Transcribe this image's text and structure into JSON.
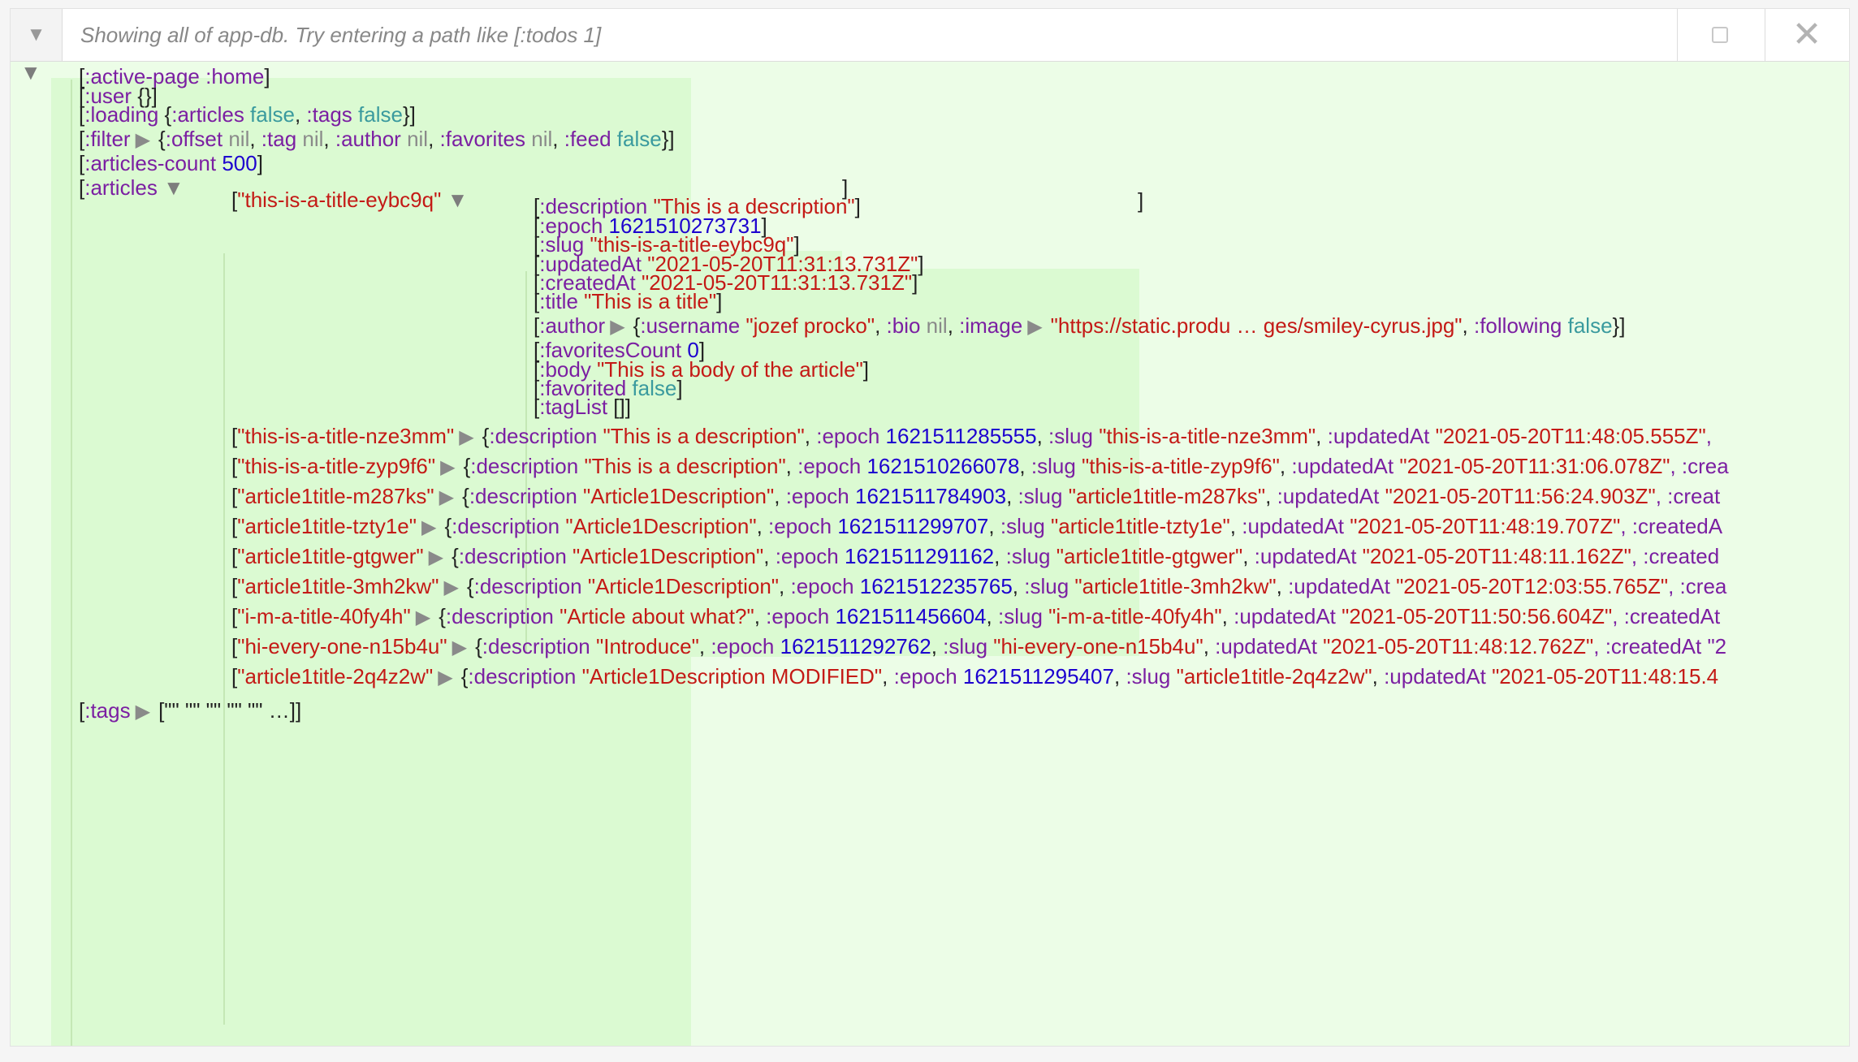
{
  "header": {
    "path_placeholder": "Showing all of app-db. Try entering a path like [:todos 1]",
    "toggle_icon": "triangle-down-icon",
    "checkbox_icon": "checkbox-icon",
    "close_icon": "close-icon"
  },
  "db": {
    "active_page": {
      "key": ":active-page",
      "value": ":home"
    },
    "user": {
      "key": ":user",
      "value": "{}"
    },
    "loading": {
      "key": ":loading",
      "k1": ":articles",
      "v1": "false",
      "k2": ":tags",
      "v2": "false"
    },
    "filter": {
      "key": ":filter",
      "k1": ":offset",
      "v1": "nil",
      "k2": ":tag",
      "v2": "nil",
      "k3": ":author",
      "v3": "nil",
      "k4": ":favorites",
      "v4": "nil",
      "k5": ":feed",
      "v5": "false"
    },
    "articles_count": {
      "key": ":articles-count",
      "value": "500"
    },
    "articles": {
      "key": ":articles",
      "expanded": {
        "slug": "\"this-is-a-title-eybc9q\"",
        "fields": {
          "description": {
            "key": ":description",
            "value": "\"This is a description\""
          },
          "epoch": {
            "key": ":epoch",
            "value": "1621510273731"
          },
          "slug": {
            "key": ":slug",
            "value": "\"this-is-a-title-eybc9q\""
          },
          "updatedAt": {
            "key": ":updatedAt",
            "value": "\"2021-05-20T11:31:13.731Z\""
          },
          "createdAt": {
            "key": ":createdAt",
            "value": "\"2021-05-20T11:31:13.731Z\""
          },
          "title": {
            "key": ":title",
            "value": "\"This is a title\""
          },
          "author": {
            "key": ":author",
            "k_username": ":username",
            "v_username": "\"jozef procko\"",
            "k_bio": ":bio",
            "v_bio": "nil",
            "k_image": ":image",
            "v_image": "\"https://static.produ … ges/smiley-cyrus.jpg\"",
            "k_following": ":following",
            "v_following": "false"
          },
          "favoritesCount": {
            "key": ":favoritesCount",
            "value": "0"
          },
          "body": {
            "key": ":body",
            "value": "\"This is a body of the article\""
          },
          "favorited": {
            "key": ":favorited",
            "value": "false"
          },
          "tagList": {
            "key": ":tagList",
            "value": "[]"
          }
        }
      },
      "rows": [
        {
          "slug": "\"this-is-a-title-nze3mm\"",
          "desc": "\"This is a description\"",
          "epoch": "1621511285555",
          "slug2": "\"this-is-a-title-nze3mm\"",
          "updated": "\"2021-05-20T11:48:05.555Z\"",
          "tail": ","
        },
        {
          "slug": "\"this-is-a-title-zyp9f6\"",
          "desc": "\"This is a description\"",
          "epoch": "1621510266078",
          "slug2": "\"this-is-a-title-zyp9f6\"",
          "updated": "\"2021-05-20T11:31:06.078Z\"",
          "tail": ", :crea"
        },
        {
          "slug": "\"article1title-m287ks\"",
          "desc": "\"Article1Description\"",
          "epoch": "1621511784903",
          "slug2": "\"article1title-m287ks\"",
          "updated": "\"2021-05-20T11:56:24.903Z\"",
          "tail": ", :creat"
        },
        {
          "slug": "\"article1title-tzty1e\"",
          "desc": "\"Article1Description\"",
          "epoch": "1621511299707",
          "slug2": "\"article1title-tzty1e\"",
          "updated": "\"2021-05-20T11:48:19.707Z\"",
          "tail": ", :createdA"
        },
        {
          "slug": "\"article1title-gtgwer\"",
          "desc": "\"Article1Description\"",
          "epoch": "1621511291162",
          "slug2": "\"article1title-gtgwer\"",
          "updated": "\"2021-05-20T11:48:11.162Z\"",
          "tail": ", :created"
        },
        {
          "slug": "\"article1title-3mh2kw\"",
          "desc": "\"Article1Description\"",
          "epoch": "1621512235765",
          "slug2": "\"article1title-3mh2kw\"",
          "updated": "\"2021-05-20T12:03:55.765Z\"",
          "tail": ", :crea"
        },
        {
          "slug": "\"i-m-a-title-40fy4h\"",
          "desc": "\"Article about what?\"",
          "epoch": "1621511456604",
          "slug2": "\"i-m-a-title-40fy4h\"",
          "updated": "\"2021-05-20T11:50:56.604Z\"",
          "tail": ", :createdAt"
        },
        {
          "slug": "\"hi-every-one-n15b4u\"",
          "desc": "\"Introduce\"",
          "epoch": "1621511292762",
          "slug2": "\"hi-every-one-n15b4u\"",
          "updated": "\"2021-05-20T11:48:12.762Z\"",
          "tail": ", :createdAt \"2"
        },
        {
          "slug": "\"article1title-2q4z2w\"",
          "desc": "\"Article1Description MODIFIED\"",
          "epoch": "1621511295407",
          "slug2": "\"article1title-2q4z2w\"",
          "updated": "\"2021-05-20T11:48:15.4",
          "tail": ""
        }
      ]
    },
    "tags": {
      "key": ":tags",
      "value": "[\"\" \"\" \"\" \"\" \"\" …]"
    }
  }
}
